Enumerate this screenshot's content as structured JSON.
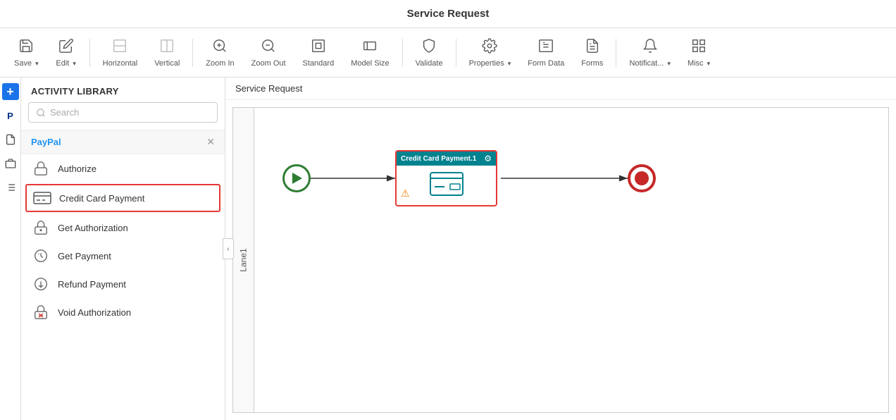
{
  "topbar": {
    "title": "Service Request"
  },
  "toolbar": {
    "items": [
      {
        "id": "save",
        "label": "Save",
        "icon": "💾",
        "dropdown": true
      },
      {
        "id": "edit",
        "label": "Edit",
        "icon": "✏️",
        "dropdown": true
      },
      {
        "id": "horizontal",
        "label": "Horizontal",
        "icon": "⬜",
        "dropdown": false
      },
      {
        "id": "vertical",
        "label": "Vertical",
        "icon": "▭",
        "dropdown": false
      },
      {
        "id": "zoom-in",
        "label": "Zoom In",
        "icon": "🔍+",
        "dropdown": false
      },
      {
        "id": "zoom-out",
        "label": "Zoom Out",
        "icon": "🔍-",
        "dropdown": false
      },
      {
        "id": "standard",
        "label": "Standard",
        "icon": "⬛",
        "dropdown": false
      },
      {
        "id": "model-size",
        "label": "Model Size",
        "icon": "⬜",
        "dropdown": false
      },
      {
        "id": "validate",
        "label": "Validate",
        "icon": "✅",
        "dropdown": false
      },
      {
        "id": "properties",
        "label": "Properties",
        "icon": "⚙️",
        "dropdown": true
      },
      {
        "id": "form-data",
        "label": "Form Data",
        "icon": "📊",
        "dropdown": false
      },
      {
        "id": "forms",
        "label": "Forms",
        "icon": "📄",
        "dropdown": false
      },
      {
        "id": "notifications",
        "label": "Notificat...",
        "icon": "🔔",
        "dropdown": true
      },
      {
        "id": "misc",
        "label": "Misc",
        "icon": "🗂",
        "dropdown": true
      }
    ]
  },
  "sidebar": {
    "header": "Activity Library",
    "search_placeholder": "Search",
    "section": {
      "title": "PayPal",
      "items": [
        {
          "id": "authorize",
          "label": "Authorize",
          "icon_type": "lock"
        },
        {
          "id": "credit-card-payment",
          "label": "Credit Card Payment",
          "icon_type": "card",
          "selected": true
        },
        {
          "id": "get-authorization",
          "label": "Get Authorization",
          "icon_type": "lock-dollar"
        },
        {
          "id": "get-payment",
          "label": "Get Payment",
          "icon_type": "dollar"
        },
        {
          "id": "refund-payment",
          "label": "Refund Payment",
          "icon_type": "refund"
        },
        {
          "id": "void-authorization",
          "label": "Void Authorization",
          "icon_type": "lock-x"
        }
      ]
    }
  },
  "canvas": {
    "title": "Service Request",
    "lane_label": "Lane1",
    "task": {
      "title": "Credit Card Payment.1",
      "warning": true
    }
  },
  "iconbar": {
    "items": [
      {
        "id": "add",
        "icon": "+",
        "active": true
      },
      {
        "id": "paypal",
        "icon": "P",
        "active": false
      },
      {
        "id": "document",
        "icon": "📋",
        "active": false
      },
      {
        "id": "id-card",
        "icon": "🪪",
        "active": false
      },
      {
        "id": "list",
        "icon": "≡",
        "active": false
      }
    ]
  }
}
